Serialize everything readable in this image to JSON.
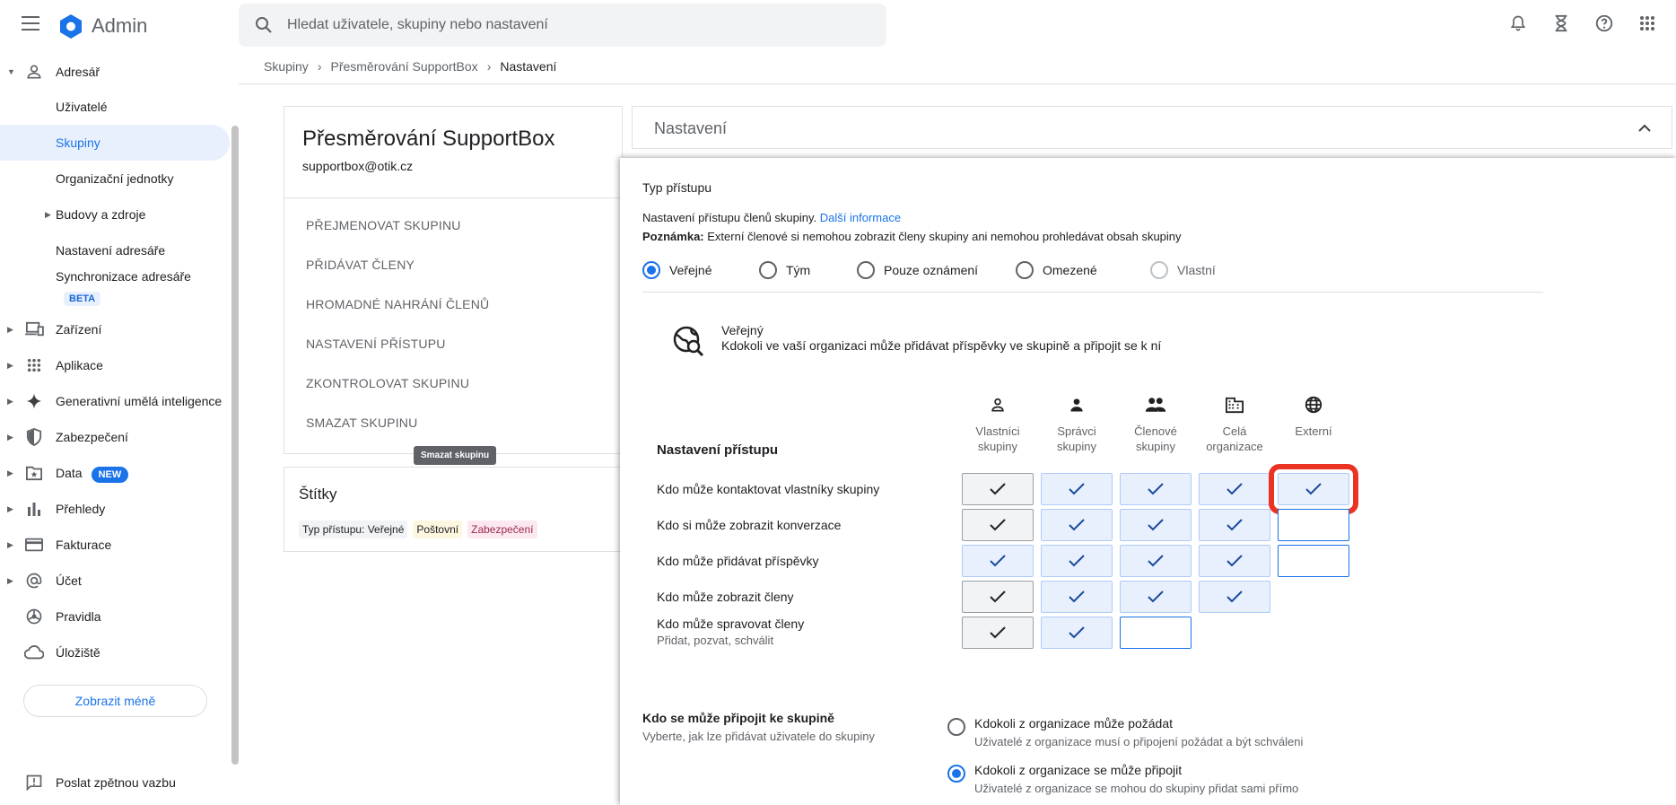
{
  "app": {
    "title": "Admin"
  },
  "search": {
    "placeholder": "Hledat uživatele, skupiny nebo nastavení"
  },
  "breadcrumb": {
    "items": [
      "Skupiny",
      "Přesměrování SupportBox",
      "Nastavení"
    ]
  },
  "sidebar": {
    "section": "Adresář",
    "sub_items": [
      "Uživatelé",
      "Skupiny",
      "Organizační jednotky",
      "Budovy a zdroje",
      "Nastavení adresáře",
      "Synchronizace adresáře"
    ],
    "beta": "BETA",
    "items": [
      "Zařízení",
      "Aplikace",
      "Generativní umělá inteligence",
      "Zabezpečení",
      "Data",
      "Přehledy",
      "Fakturace",
      "Účet",
      "Pravidla",
      "Úložiště"
    ],
    "new_badge": "NEW",
    "show_less": "Zobrazit méně",
    "feedback": "Poslat zpětnou vazbu"
  },
  "group": {
    "title": "Přesměrování SupportBox",
    "email": "supportbox@otik.cz",
    "actions": [
      "PŘEJMENOVAT SKUPINU",
      "PŘIDÁVAT ČLENY",
      "HROMADNÉ NAHRÁNÍ ČLENŮ",
      "NASTAVENÍ PŘÍSTUPU",
      "ZKONTROLOVAT SKUPINU",
      "SMAZAT SKUPINU"
    ],
    "tooltip": "Smazat skupinu"
  },
  "tags": {
    "title": "Štítky",
    "items": [
      "Typ přístupu: Veřejné",
      "Poštovní",
      "Zabezpečení"
    ]
  },
  "settings": {
    "title": "Nastavení"
  },
  "panel": {
    "heading": "Typ přístupu",
    "desc": "Nastavení přístupu členů skupiny.",
    "more_link": "Další informace",
    "note_label": "Poznámka:",
    "note": "Externí členové si nemohou zobrazit členy skupiny ani nemohou prohledávat obsah skupiny",
    "access_types": [
      "Veřejné",
      "Tým",
      "Pouze oznámení",
      "Omezené",
      "Vlastní"
    ],
    "selected_access": "Veřejné",
    "public_title": "Veřejný",
    "public_desc": "Kdokoli ve vaší organizaci může přidávat příspěvky ve skupině a připojit se k ní",
    "access_heading": "Nastavení přístupu",
    "columns": [
      {
        "label": "Vlastníci skupiny",
        "icon": "person-outline-icon"
      },
      {
        "label": "Správci skupiny",
        "icon": "person-icon"
      },
      {
        "label": "Členové skupiny",
        "icon": "people-icon"
      },
      {
        "label": "Celá organizace",
        "icon": "building-icon"
      },
      {
        "label": "Externí",
        "icon": "globe-icon"
      }
    ],
    "rows": [
      {
        "label": "Kdo může kontaktovat vlastníky skupiny",
        "sub": "",
        "cells": [
          "checked-gray",
          "checked",
          "checked",
          "checked",
          "checked"
        ]
      },
      {
        "label": "Kdo si může zobrazit konverzace",
        "sub": "",
        "cells": [
          "checked-gray",
          "checked",
          "checked",
          "checked",
          "empty"
        ]
      },
      {
        "label": "Kdo může přidávat příspěvky",
        "sub": "",
        "cells": [
          "checked",
          "checked",
          "checked",
          "checked",
          "empty"
        ]
      },
      {
        "label": "Kdo může zobrazit členy",
        "sub": "",
        "cells": [
          "checked-gray",
          "checked",
          "checked",
          "checked",
          "none"
        ]
      },
      {
        "label": "Kdo může spravovat členy",
        "sub": "Přidat, pozvat, schválit",
        "cells": [
          "checked-gray",
          "checked",
          "empty",
          "none",
          "none"
        ]
      }
    ],
    "join_heading": "Kdo se může připojit ke skupině",
    "join_sub": "Vyberte, jak lze přidávat uživatele do skupiny",
    "join_options": [
      {
        "title": "Kdokoli z organizace může požádat",
        "sub": "Uživatelé z organizace musí o připojení požádat a být schváleni",
        "selected": false
      },
      {
        "title": "Kdokoli z organizace se může připojit",
        "sub": "Uživatelé z organizace se mohou do skupiny přidat sami přímo",
        "selected": true
      }
    ]
  },
  "colors": {
    "accent": "#1a73e8",
    "highlight": "#ea3323"
  }
}
